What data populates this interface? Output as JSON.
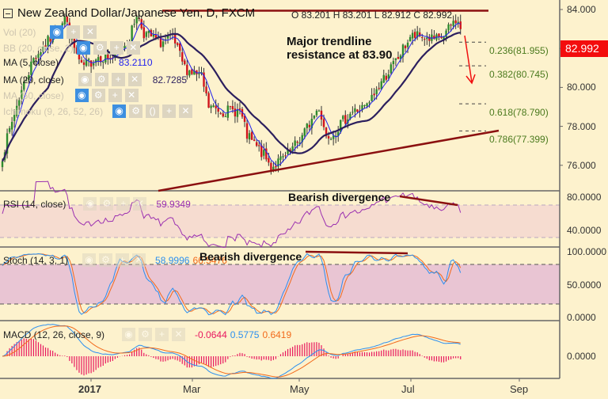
{
  "header": {
    "title": "New Zealand Dollar/Japanese Yen, D, FXCM",
    "ohlc": "O 83.201  H 83.201  L 82.912  C 82.992",
    "last_price": "82.992"
  },
  "legend": {
    "vol": "Vol (20)",
    "bb": "BB (20, close, 2)",
    "ma5": "MA (5, close)",
    "ma5_value": "83.2110",
    "ma20": "MA (20, close)",
    "ma20_value": "82.7285",
    "ma50": "MA (50, close)",
    "ichimoku": "Ichimoku (9, 26, 52, 26)",
    "rsi": "RSI (14, close)",
    "rsi_value": "59.9349",
    "stoch": "Stoch (14, 3, 1)",
    "stoch_k": "58.9996",
    "stoch_d": "66.5476",
    "macd": "MACD (12, 26, close, 9)",
    "macd_hist": "-0.0644",
    "macd_line": "0.5775",
    "macd_signal": "0.6419"
  },
  "annotations": {
    "main": "Major trendline\nresistance at 83.90",
    "rsi_div": "Bearish divergence",
    "stoch_div": "Bearish divergence"
  },
  "colors": {
    "up": "#2e8b2e",
    "down": "#d0141b",
    "ma5": "#2222ee",
    "ma20": "#2c1f5e",
    "rsi": "#9b30b0",
    "k": "#2b8ff0",
    "d": "#f26a1b",
    "hist": "#e8185f",
    "trend": "#8b1010"
  },
  "chart_data": {
    "type": "candlestick",
    "title": "New Zealand Dollar/Japanese Yen, D, FXCM",
    "ylim": [
      75.5,
      84.5
    ],
    "yticks": [
      "84.000",
      "82.000",
      "80.000",
      "78.000",
      "76.000"
    ],
    "rsi_ticks": [
      "80.0000",
      "40.0000"
    ],
    "stoch_ticks": [
      "100.0000",
      "50.0000",
      "0.0000"
    ],
    "macd_ticks": [
      "0.0000"
    ],
    "xticks": [
      "2017",
      "Mar",
      "May",
      "Jul",
      "Sep"
    ],
    "close_waypoints": [
      [
        0,
        76.5
      ],
      [
        7,
        79.5
      ],
      [
        13,
        81.5
      ],
      [
        20,
        82.5
      ],
      [
        26,
        83.6
      ],
      [
        30,
        82
      ],
      [
        33,
        81
      ],
      [
        40,
        81.6
      ],
      [
        46,
        81.5
      ],
      [
        53,
        82.5
      ],
      [
        56,
        83.8
      ],
      [
        59,
        82.8
      ],
      [
        66,
        82.3
      ],
      [
        71,
        82.5
      ],
      [
        76,
        81
      ],
      [
        83,
        80.5
      ],
      [
        86,
        79
      ],
      [
        92,
        78.8
      ],
      [
        99,
        78.8
      ],
      [
        102,
        77.5
      ],
      [
        109,
        76.5
      ],
      [
        112,
        75.9
      ],
      [
        119,
        76.5
      ],
      [
        125,
        77.5
      ],
      [
        132,
        79
      ],
      [
        135,
        77.5
      ],
      [
        139,
        77.8
      ],
      [
        145,
        78.7
      ],
      [
        152,
        79
      ],
      [
        158,
        80.3
      ],
      [
        165,
        81.5
      ],
      [
        170,
        82.6
      ],
      [
        175,
        82.6
      ],
      [
        182,
        82.4
      ],
      [
        185,
        82.8
      ],
      [
        189,
        83.5
      ],
      [
        191,
        82.992
      ]
    ],
    "resistance": 83.9,
    "fibonacci": [
      {
        "label": "0.236(81.955)",
        "price": 81.955
      },
      {
        "label": "0.382(80.745)",
        "price": 80.745
      },
      {
        "label": "0.618(78.790)",
        "price": 78.79
      },
      {
        "label": "0.786(77.399)",
        "price": 77.399
      }
    ]
  }
}
